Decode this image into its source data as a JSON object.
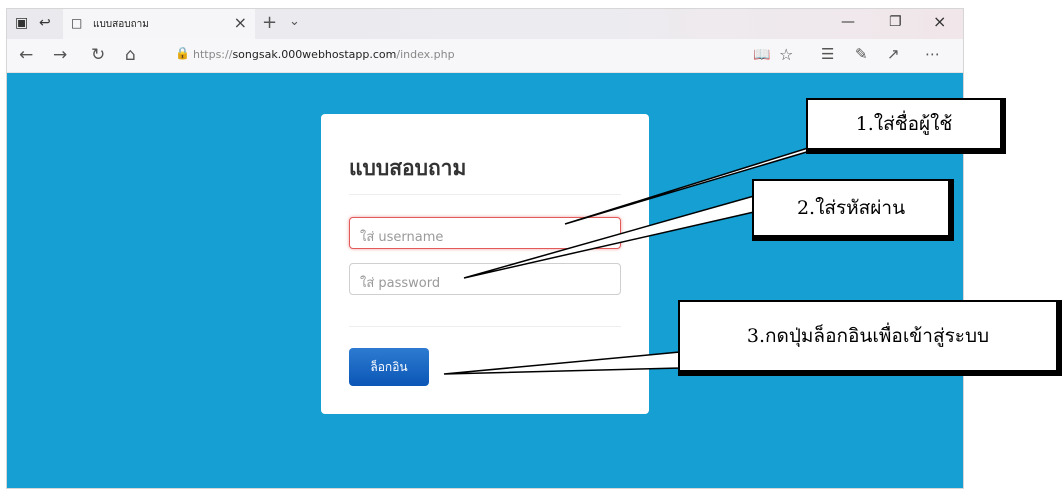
{
  "browser": {
    "tab_title": "แบบสอบถาม",
    "url_prefix": "https://",
    "url_host": "songsak.000webhostapp.com",
    "url_path": "/index.php"
  },
  "form": {
    "title": "แบบสอบถาม",
    "username_placeholder": "ใส่ username",
    "password_placeholder": "ใส่ password",
    "login_label": "ล็อกอิน"
  },
  "callouts": {
    "step1": "1.ใส่ชื่อผู้ใช้",
    "step2": "2.ใส่รหัสผ่าน",
    "step3": "3.กดปุ่มล็อกอินเพื่อเข้าสู่ระบบ"
  },
  "colors": {
    "page_background": "#159fd2",
    "login_button": "#0b56b6",
    "error_border": "#e35a5a"
  }
}
